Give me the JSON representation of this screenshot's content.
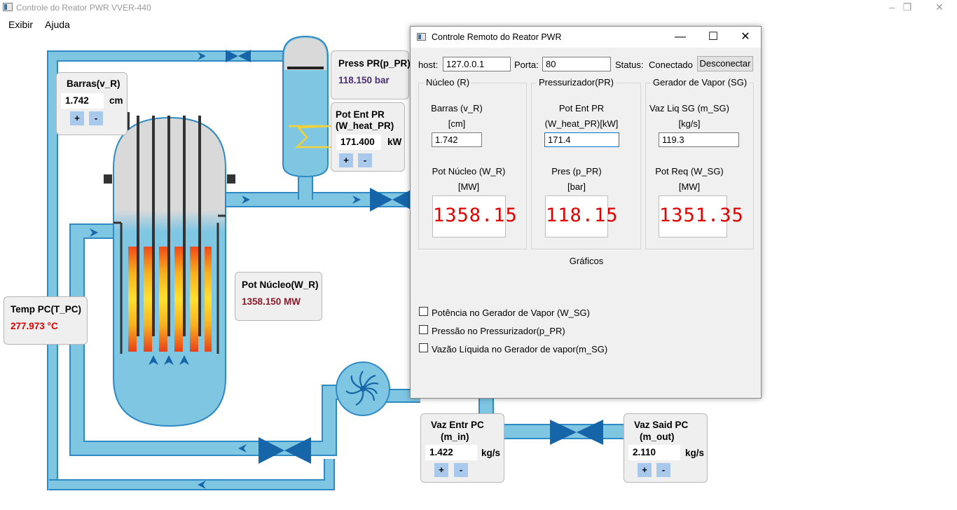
{
  "window": {
    "title": "Controle do Reator PWR VVER-440",
    "minimize_glyph": "–",
    "restore_glyph": "❐",
    "close_glyph": "✕"
  },
  "menu": {
    "items": [
      "Exibir",
      "Ajuda"
    ]
  },
  "panels": {
    "rods": {
      "label": "Barras(v_R)",
      "value": "1.742",
      "unit": "cm",
      "plus": "+",
      "minus": "-"
    },
    "pressure": {
      "label": "Press PR(p_PR)",
      "value": "118.150 bar"
    },
    "heater": {
      "label_line1": "Pot Ent PR",
      "label_line2": "(W_heat_PR)",
      "value": "171.400",
      "unit": "kW",
      "plus": "+",
      "minus": "-"
    },
    "core_power": {
      "label": "Pot Núcleo(W_R)",
      "value": "1358.150 MW"
    },
    "temperature": {
      "label": "Temp PC(T_PC)",
      "value": "277.973 °C"
    },
    "flow_in": {
      "label_line1": "Vaz Entr PC",
      "label_line2": "(m_in)",
      "value": "1.422",
      "unit": "kg/s",
      "plus": "+",
      "minus": "-"
    },
    "flow_out": {
      "label_line1": "Vaz Said PC",
      "label_line2": "(m_out)",
      "value": "2.110",
      "unit": "kg/s",
      "plus": "+",
      "minus": "-"
    }
  },
  "remote": {
    "title": "Controle Remoto do Reator PWR",
    "minimize_glyph": "—",
    "maximize_glyph": "☐",
    "close_glyph": "✕",
    "host_label": "host:",
    "host_value": "127.0.0.1",
    "port_label": "Porta:",
    "port_value": "80",
    "status_label": "Status:",
    "status_value": "Conectado",
    "disconnect_label": "Desconectar",
    "groups": {
      "core": {
        "title": "Núcleo (R)",
        "input_label": "Barras (v_R)",
        "input_unit": "[cm]",
        "input_value": "1.742",
        "display_label": "Pot Núcleo (W_R)",
        "display_unit": "[MW]",
        "display_value": "1358.15"
      },
      "pressurizer": {
        "title": "Pressurizador(PR)",
        "input_label": "Pot Ent PR",
        "input_unit": "(W_heat_PR)[kW]",
        "input_value": "171.4",
        "display_label": "Pres (p_PR)",
        "display_unit": "[bar]",
        "display_value": "118.15"
      },
      "steam_generator": {
        "title": "Gerador de Vapor (SG)",
        "input_label": "Vaz Liq SG (m_SG)",
        "input_unit": "[kg/s]",
        "input_value": "119.3",
        "display_label": "Pot Req (W_SG)",
        "display_unit": "[MW]",
        "display_value": "1351.35"
      }
    },
    "graphs_title": "Gráficos",
    "graphs": [
      {
        "label": "Potência no Gerador de Vapor (W_SG)",
        "checked": false
      },
      {
        "label": "Pressão no Pressurizador(p_PR)",
        "checked": false
      },
      {
        "label": "Vazão Líquida no Gerador de vapor(m_SG)",
        "checked": false
      }
    ]
  },
  "colors": {
    "pipe": "#7fc6e3",
    "pipe_edge": "#2f89c4",
    "valve": "#1565a8",
    "vessel_gas": "#d9d9d9",
    "lcd_digits": "#e00000",
    "temperature_text": "#e00000",
    "power_text": "#8b1a2b",
    "pressure_text": "#4b2e6f"
  },
  "icons": [
    "window-icon",
    "valve-icon",
    "pump-icon",
    "flow-arrow-icon",
    "heater-coil-icon",
    "checkbox-icon"
  ]
}
